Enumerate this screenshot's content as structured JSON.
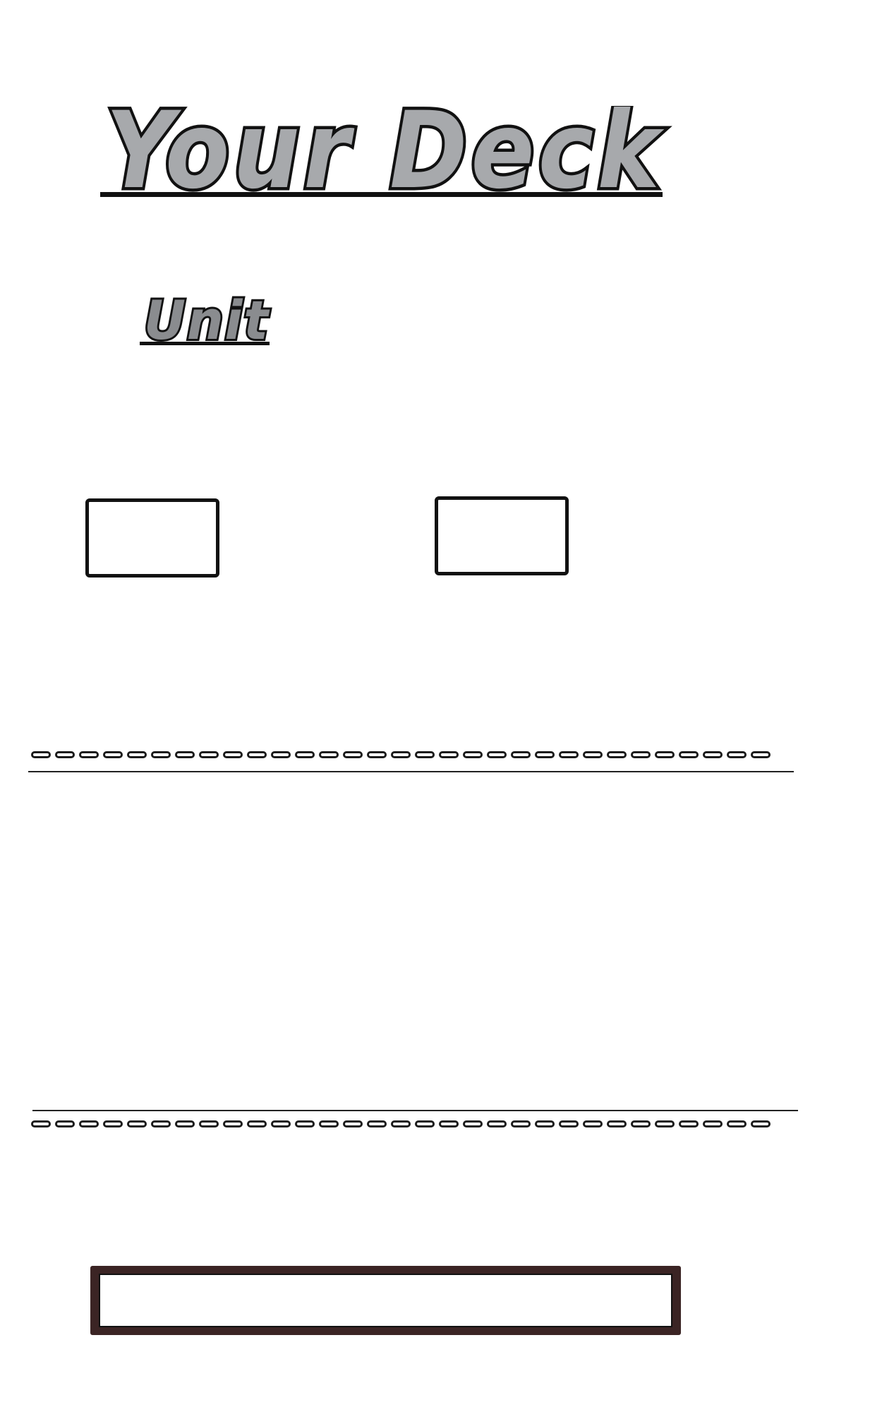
{
  "header": {
    "title": "Your Deck",
    "subtitle": "Unit"
  },
  "colors": {
    "title_fill": "#a7a9ac",
    "title_stroke": "#111111",
    "subtitle_fill": "#8a8c8f",
    "bar_border": "#3b2424"
  },
  "card_slots": [
    {
      "index": 1
    },
    {
      "index": 2
    }
  ],
  "divider_links": 31
}
